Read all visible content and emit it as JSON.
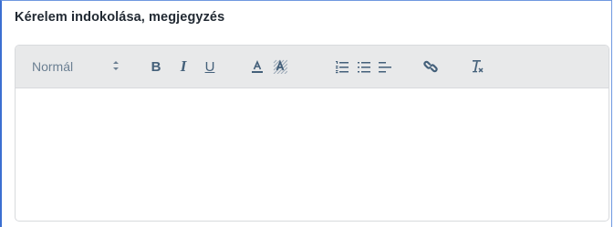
{
  "field": {
    "label": "Kérelem indokolása, megjegyzés"
  },
  "toolbar": {
    "format_value": "Normál",
    "format_options": [
      "Normál"
    ],
    "bold_label": "B",
    "italic_label": "I",
    "underline_label": "U",
    "icons": [
      "chevron-updown-icon",
      "bold-icon",
      "italic-icon",
      "underline-icon",
      "font-color-icon",
      "background-color-icon",
      "ordered-list-icon",
      "bullet-list-icon",
      "align-icon",
      "link-icon",
      "clear-format-icon"
    ]
  },
  "editor": {
    "content": ""
  },
  "colors": {
    "accent_border": "#3b6fd1",
    "toolbar_bg": "#e8e9ea",
    "icon": "#44607a"
  }
}
